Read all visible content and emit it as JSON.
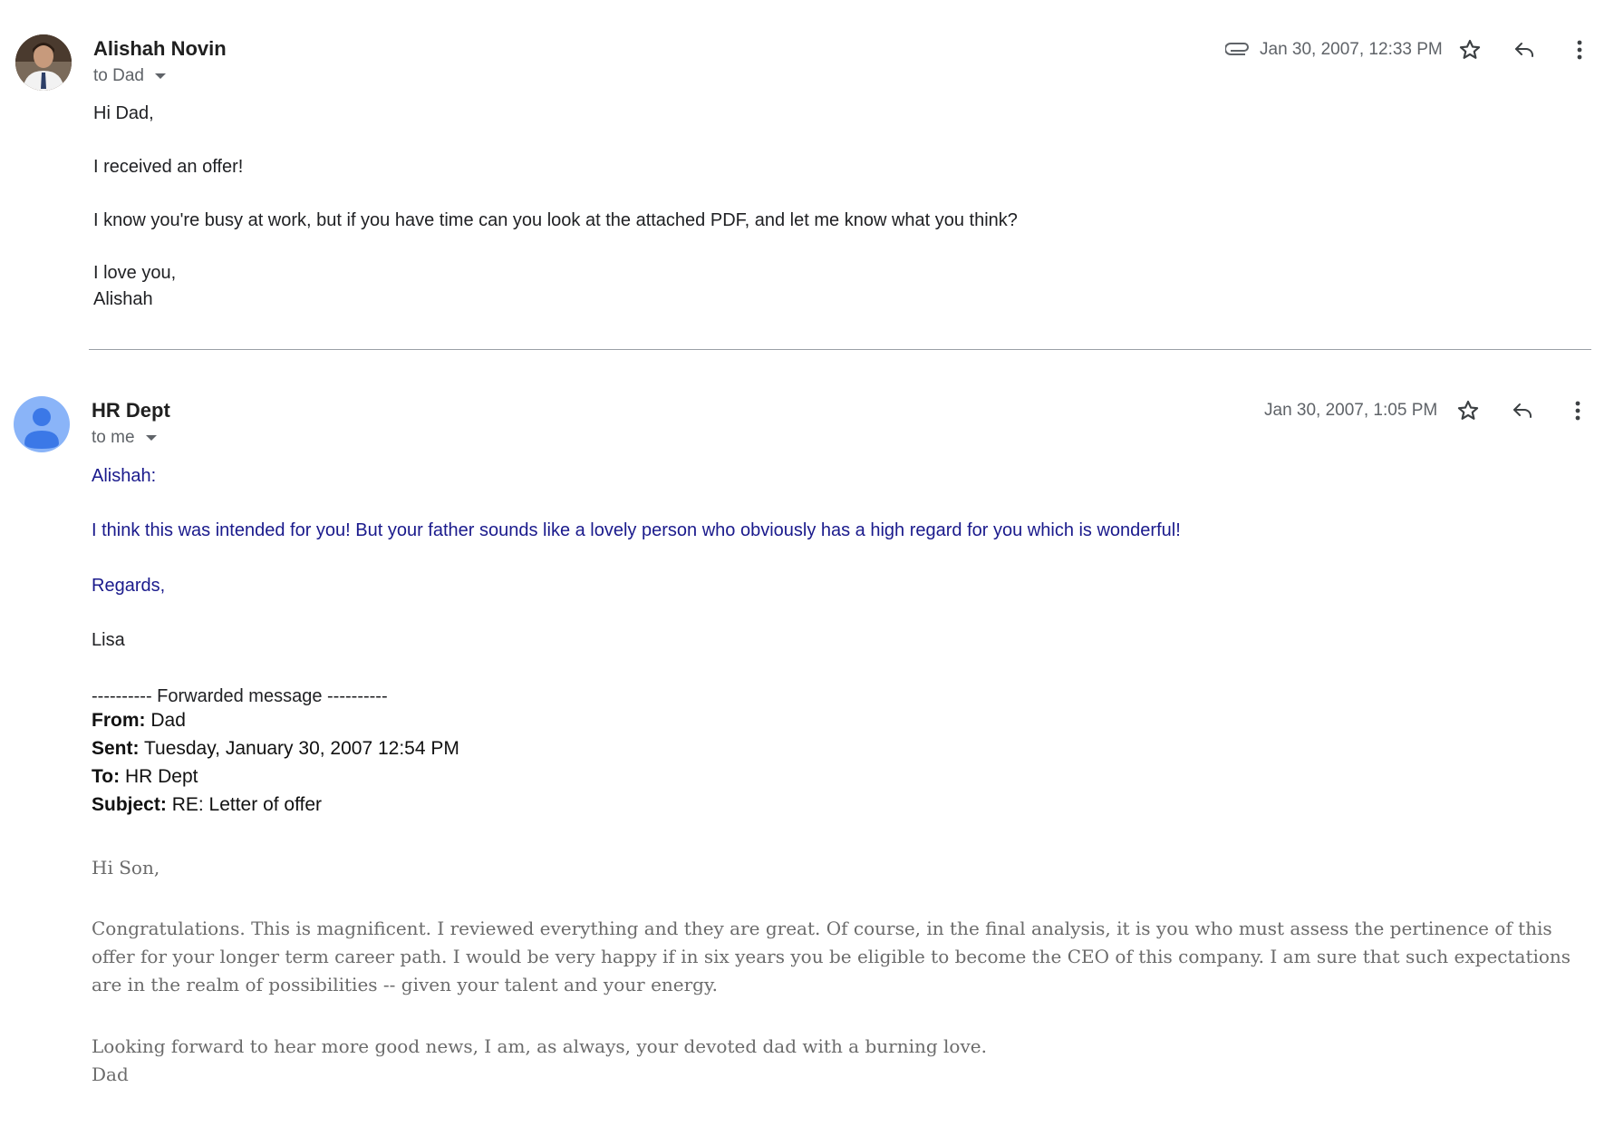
{
  "messages": [
    {
      "sender": "Alishah Novin",
      "recipient": "to Dad",
      "date": "Jan 30, 2007, 12:33 PM",
      "has_attachment": true,
      "body": {
        "greeting": "Hi Dad,",
        "line1": "I received an offer!",
        "line2": "I know you're busy at work, but if you have time can you look at the attached PDF, and let me know what you think?",
        "closing": "I love you,",
        "signature": "Alishah"
      }
    },
    {
      "sender": "HR Dept",
      "recipient": "to me",
      "date": "Jan 30, 2007, 1:05 PM",
      "body": {
        "greeting": "Alishah:",
        "line1": "I think this was intended for you!  But your father sounds like a lovely person who obviously has a high regard for you which is wonderful!",
        "regards": "Regards,",
        "signature": "Lisa"
      },
      "forwarded": {
        "separator": "---------- Forwarded message ----------",
        "from_label": "From:",
        "from_value": "Dad",
        "sent_label": "Sent:",
        "sent_value": "Tuesday, January 30, 2007 12:54 PM",
        "to_label": "To:",
        "to_value": "HR Dept",
        "subject_label": "Subject:",
        "subject_value": "RE: Letter of offer",
        "greeting": "Hi Son,",
        "paragraph": "Congratulations. This is magnificent. I reviewed everything and they are great. Of course, in the final analysis, it is you who must assess the pertinence of this offer for your longer term career path. I would be very happy if in six years you be eligible to become the CEO of this company. I am sure that such expectations are in the realm of possibilities -- given your talent and your energy.",
        "closing": "Looking forward to hear more good news, I am, as always, your devoted dad with a burning love.",
        "signature": "Dad"
      }
    }
  ],
  "icons": [
    "paperclip-icon",
    "star-icon",
    "reply-icon",
    "more-vert-icon",
    "chevron-down-icon",
    "person-icon"
  ],
  "colors": {
    "hr_text": "#1a1a8c",
    "dad_text": "#6b6b6b",
    "avatar_default": "#8ab4f8"
  }
}
